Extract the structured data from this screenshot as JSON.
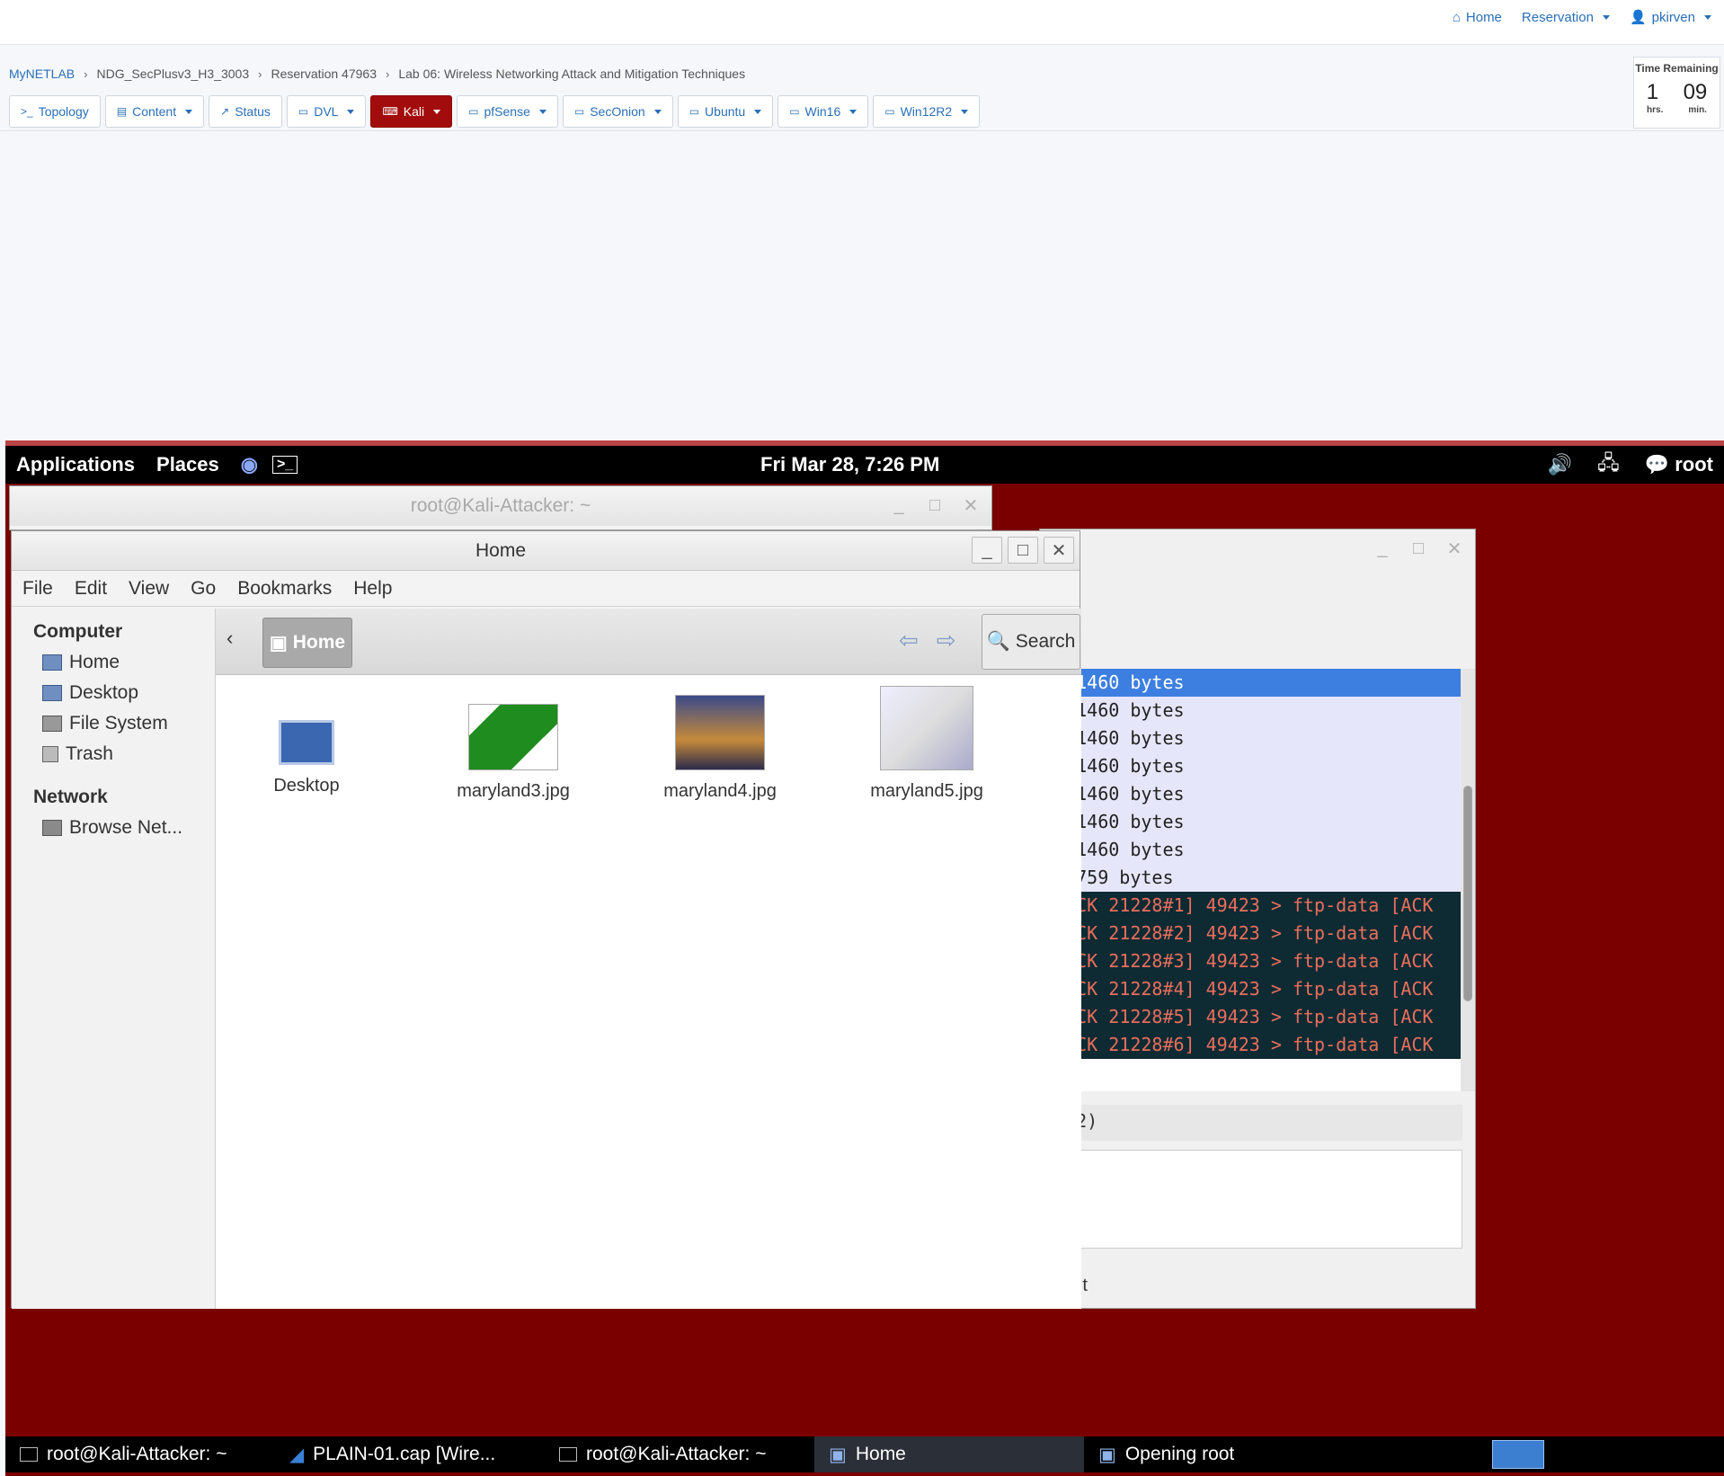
{
  "topnav": {
    "home": "Home",
    "reservation": "Reservation",
    "user": "pkirven"
  },
  "breadcrumb": [
    "MyNETLAB",
    "NDG_SecPlusv3_H3_3003",
    "Reservation 47963",
    "Lab 06: Wireless Networking Attack and Mitigation Techniques"
  ],
  "tabs": [
    "Topology",
    "Content",
    "Status",
    "DVL",
    "Kali",
    "pfSense",
    "SecOnion",
    "Ubuntu",
    "Win16",
    "Win12R2"
  ],
  "timer": {
    "title": "Time Remaining",
    "hours": "1",
    "minutes": "09",
    "hours_label": "hrs.",
    "minutes_label": "min."
  },
  "panel": {
    "applications": "Applications",
    "places": "Places",
    "clock": "Fri Mar 28,  7:26 PM",
    "user": "root"
  },
  "terminal": {
    "title": "root@Kali-Attacker: ~"
  },
  "wireshark": {
    "rows": [
      {
        "text": "a: 1460 bytes",
        "style": "sel"
      },
      {
        "text": "a: 1460 bytes",
        "style": "lav"
      },
      {
        "text": "a: 1460 bytes",
        "style": "lav"
      },
      {
        "text": "a: 1460 bytes",
        "style": "lav"
      },
      {
        "text": "a: 1460 bytes",
        "style": "lav"
      },
      {
        "text": "a: 1460 bytes",
        "style": "lav"
      },
      {
        "text": "a: 1460 bytes",
        "style": "lav"
      },
      {
        "text": "a: 759 bytes",
        "style": "lav"
      },
      {
        "text": "o ACK 21228#1] 49423 > ftp-data [ACK",
        "style": "dark"
      },
      {
        "text": "o ACK 21228#2] 49423 > ftp-data [ACK",
        "style": "dark"
      },
      {
        "text": "o ACK 21228#3] 49423 > ftp-data [ACK",
        "style": "dark"
      },
      {
        "text": "o ACK 21228#4] 49423 > ftp-data [ACK",
        "style": "dark"
      },
      {
        "text": "o ACK 21228#5] 49423 > ftp-data [ACK",
        "style": "dark"
      },
      {
        "text": "o ACK 21228#6] 49423 > ftp-data [ACK",
        "style": "dark"
      }
    ],
    "detail": ".2.2)",
    "status": "efault"
  },
  "filemanager": {
    "title": "Home",
    "menu": [
      "File",
      "Edit",
      "View",
      "Go",
      "Bookmarks",
      "Help"
    ],
    "sidebar": {
      "computer_header": "Computer",
      "computer_items": [
        "Home",
        "Desktop",
        "File System",
        "Trash"
      ],
      "network_header": "Network",
      "network_items": [
        "Browse Net..."
      ]
    },
    "location": "Home",
    "search": "Search",
    "items": [
      "Desktop",
      "maryland3.jpg",
      "maryland4.jpg",
      "maryland5.jpg"
    ]
  },
  "taskbar": [
    "root@Kali-Attacker: ~",
    "PLAIN-01.cap   [Wire...",
    "root@Kali-Attacker: ~",
    "Home",
    "Opening root"
  ]
}
